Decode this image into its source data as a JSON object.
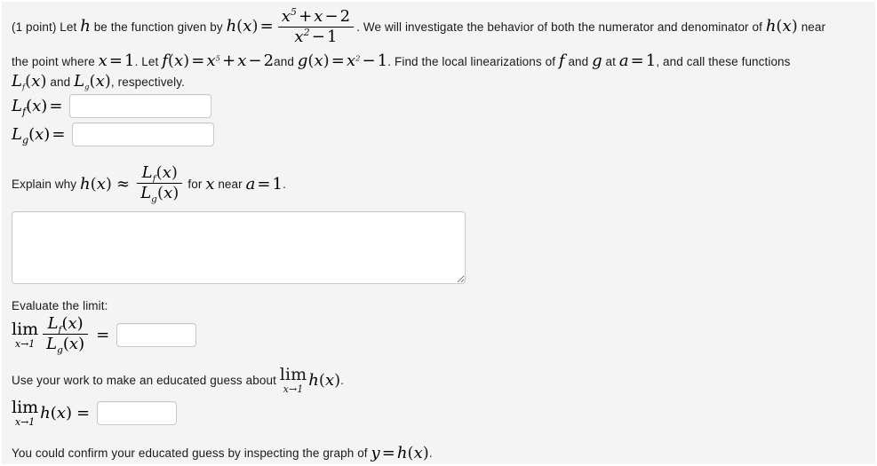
{
  "page": {
    "background_color": "#f4f4f4",
    "text_color": "#1a1a1a",
    "border_color": "#ffffff"
  },
  "problem": {
    "points_label": "(1 point)",
    "intro_a": "Let",
    "intro_b": "be the function given by",
    "intro_c": ". We will investigate the behavior of both the numerator and denominator of",
    "intro_d": "near",
    "line2_a": "the point where",
    "line2_b": ". Let",
    "line2_c": "and",
    "line2_d": ". Find the local linearizations of",
    "line2_e": "and",
    "line2_f": "at",
    "line2_g": ", and call these functions",
    "line3_a": "and",
    "line3_b": ", respectively."
  },
  "math": {
    "h": "h",
    "f": "f",
    "g": "g",
    "x": "x",
    "a": "a",
    "y": "y",
    "L": "L",
    "equals": "=",
    "approx": "≈",
    "plus": "+",
    "minus": "−",
    "lim": "lim",
    "limsub": "x→1",
    "one": "1",
    "two": "2",
    "exp5": "5",
    "exp2": "2",
    "numerator": "x^5 + x - 2",
    "denominator": "x^2 - 1",
    "h_formula": "h(x) = (x^5 + x - 2)/(x^2 - 1)",
    "f_formula": "f(x) = x^5 + x - 2",
    "g_formula": "g(x) = x^2 - 1",
    "a_value": "1"
  },
  "answers": {
    "lf_label": "L_f(x) =",
    "lg_label": "L_g(x) =",
    "lf_value": "",
    "lg_value": "",
    "explanation_value": "",
    "limit_ratio_value": "",
    "limit_h_value": "",
    "lf_placeholder": "",
    "lg_placeholder": "",
    "explanation_placeholder": "",
    "limit_ratio_placeholder": "",
    "limit_h_placeholder": ""
  },
  "prompts": {
    "explain_a": "Explain why",
    "explain_b": "for",
    "explain_c": "near",
    "explain_d": ".",
    "evaluate_limit": "Evaluate the limit:",
    "guess_a": "Use your work to make an educated guess about",
    "guess_b": ".",
    "confirm_a": "You could confirm your educated guess by inspecting the graph of",
    "confirm_b": "."
  }
}
